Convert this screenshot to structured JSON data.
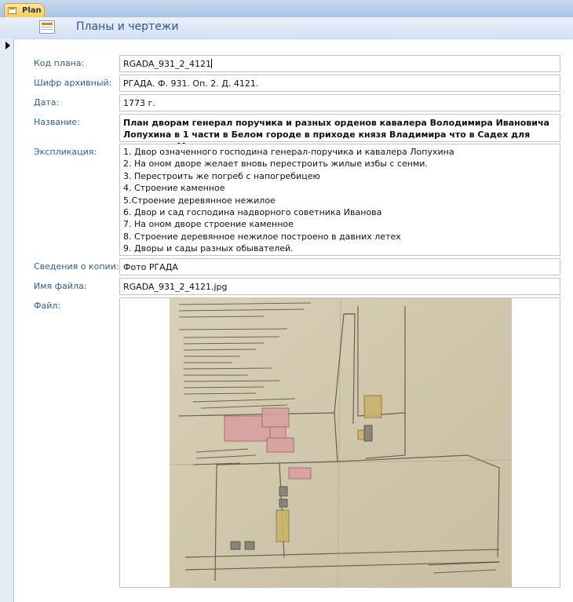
{
  "tab": {
    "label": "Plan"
  },
  "header": {
    "title": "Планы и чертежи"
  },
  "fields": {
    "code": {
      "label": "Код плана:",
      "value": "RGADA_931_2_4121"
    },
    "archive": {
      "label": "Шифр архивный:",
      "value": "РГАДА. Ф. 931. Оп. 2. Д. 4121."
    },
    "date": {
      "label": "Дата:",
      "value": "1773 г."
    },
    "title": {
      "label": "Название:",
      "value": "План дворам генерал поручика и разных орденов кавалера Володимира Ивановича Лопухина в 1 части в Белом городе в приходе князя Владимира что в Садех для подания в Московскую"
    },
    "explication": {
      "label": "Экспликация:",
      "lines": [
        "1. Двор означенного господина генерал-поручика и кавалера Лопухина",
        "2. На оном дворе желает вновь перестроить жилые избы с сенми.",
        "3. Перестроить же погреб с напогребицею",
        "4. Строение каменное",
        "5.Строение деревянное нежилое",
        "6. Двор и сад господина надворного советника Иванова",
        "7. На оном дворе строение каменное",
        "8. Строение деревянное нежилое построено в давних летех",
        "9. Дворы и сады разных обывателей."
      ]
    },
    "copy": {
      "label": "Сведения о копии:",
      "value": "Фото РГАДА"
    },
    "filename": {
      "label": "Имя файла:",
      "value": "RGADA_931_2_4121.jpg"
    },
    "file": {
      "label": "Файл:"
    }
  }
}
